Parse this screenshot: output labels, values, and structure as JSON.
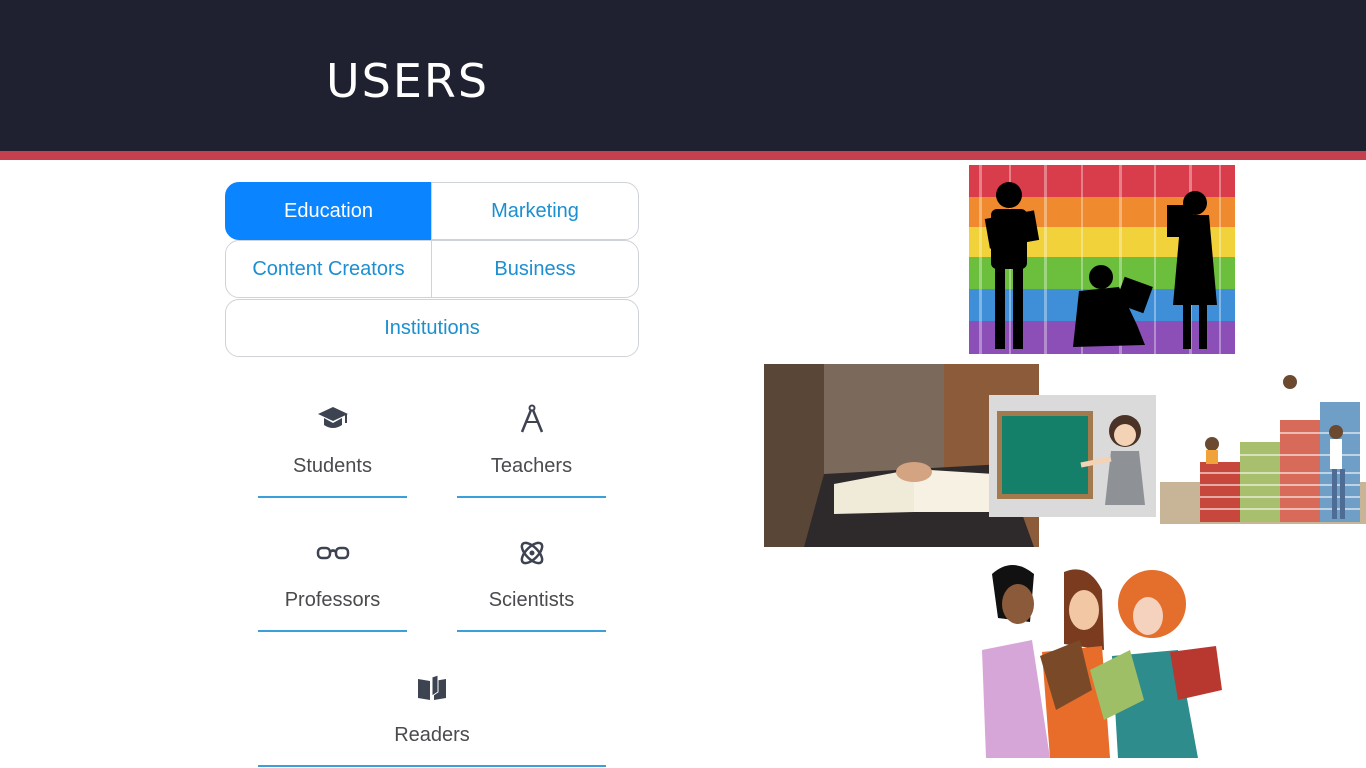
{
  "header": {
    "title": "USERS"
  },
  "colors": {
    "header_bg": "#1f2030",
    "accent": "#c4404f",
    "active_tab": "#0a84ff",
    "link": "#1b8fd1"
  },
  "tabs": [
    {
      "label": "Education",
      "active": true
    },
    {
      "label": "Marketing",
      "active": false
    },
    {
      "label": "Content Creators",
      "active": false
    },
    {
      "label": "Business",
      "active": false
    },
    {
      "label": "Institutions",
      "active": false
    }
  ],
  "users": [
    {
      "label": "Students",
      "icon": "graduation-cap-icon"
    },
    {
      "label": "Teachers",
      "icon": "compass-icon"
    },
    {
      "label": "Professors",
      "icon": "glasses-icon"
    },
    {
      "label": "Scientists",
      "icon": "atom-icon"
    },
    {
      "label": "Readers",
      "icon": "open-book-icon"
    }
  ],
  "images": [
    {
      "name": "library-silhouettes-image"
    },
    {
      "name": "reading-book-image"
    },
    {
      "name": "teacher-chalkboard-image"
    },
    {
      "name": "students-on-books-image"
    },
    {
      "name": "women-reading-image"
    }
  ]
}
